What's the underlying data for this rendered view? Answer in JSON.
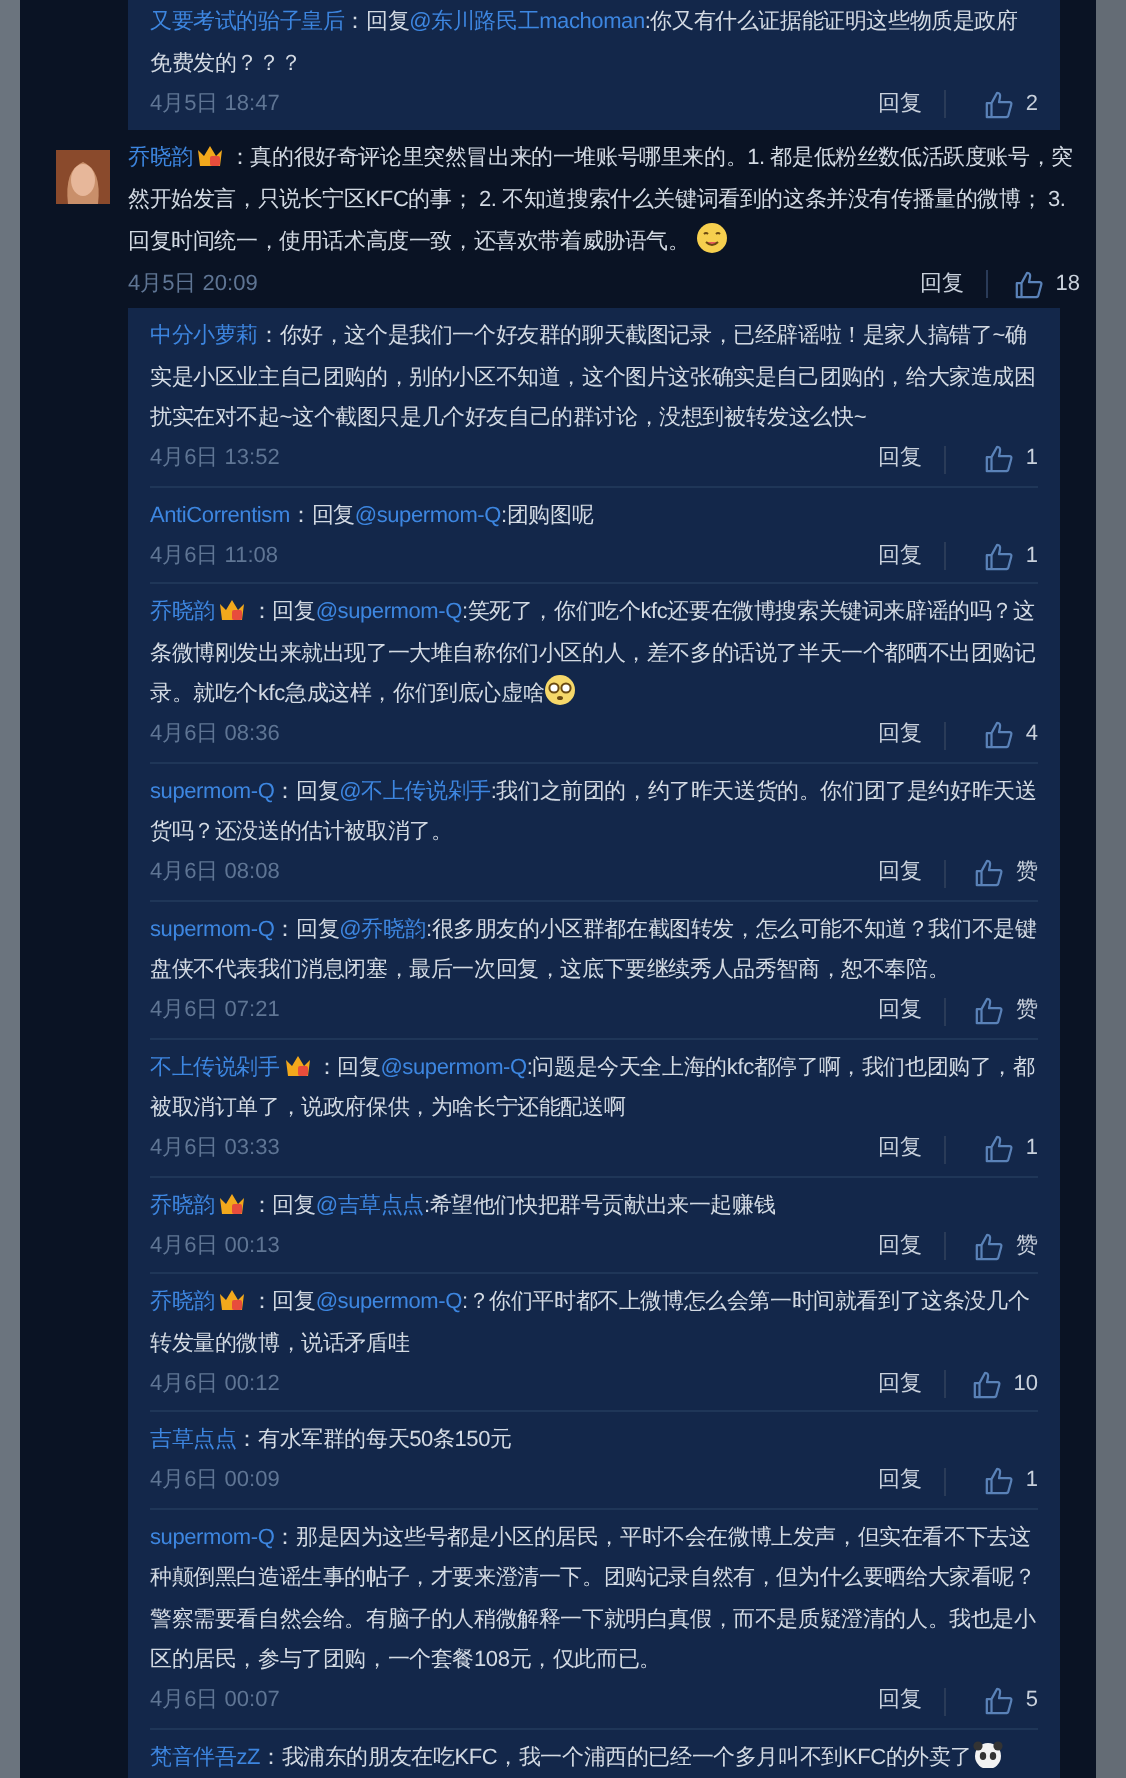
{
  "prev_replies": [
    {
      "user": "又要考试的骀子皇后",
      "badge": false,
      "lead": "：回复",
      "mention": "@东川路民工machoman",
      "text": ":你又有什么证据能证明这些物质是政府免费发的？？？",
      "time": "4月5日 18:47",
      "reply_label": "回复",
      "likes": "2"
    }
  ],
  "comment": {
    "user": "乔晓韵",
    "badge": true,
    "lead": "：",
    "text": "真的很好奇评论里突然冒出来的一堆账号哪里来的。1. 都是低粉丝数低活跃度账号，突然开始发言，只说长宁区KFC的事； 2. 不知道搜索什么关键词看到的这条并没有传播量的微博； 3. 回复时间统一，使用话术高度一致，还喜欢带着威胁语气。",
    "sticker": {
      "kind": "drool"
    },
    "time": "4月5日 20:09",
    "reply_label": "回复",
    "likes": "18"
  },
  "replies": [
    {
      "user": "中分小萝莉",
      "badge": false,
      "lead": "：",
      "text": "你好，这个是我们一个好友群的聊天截图记录，已经辟谣啦！是家人搞错了~确实是小区业主自己团购的，别的小区不知道，这个图片这张确实是自己团购的，给大家造成困扰实在对不起~这个截图只是几个好友自己的群讨论，没想到被转发这么快~",
      "time": "4月6日 13:52",
      "reply_label": "回复",
      "likes": "1"
    },
    {
      "user": "AntiCorrentism",
      "badge": false,
      "lead": "：回复",
      "mention": "@supermom-Q",
      "text": ":团购图呢",
      "time": "4月6日 11:08",
      "reply_label": "回复",
      "likes": "1"
    },
    {
      "user": "乔晓韵",
      "badge": true,
      "lead": "：回复",
      "mention": "@supermom-Q",
      "text": ":笑死了，你们吃个kfc还要在微博搜索关键词来辟谣的吗？这条微博刚发出来就出现了一大堆自称你们小区的人，差不多的话说了半天一个都晒不出团购记录。就吃个kfc急成这样，你们到底心虚啥",
      "sticker": {
        "kind": "shock"
      },
      "time": "4月6日 08:36",
      "reply_label": "回复",
      "likes": "4"
    },
    {
      "user": "supermom-Q",
      "badge": false,
      "lead": "：回复",
      "mention": "@不上传说剁手",
      "text": ":我们之前团的，约了昨天送货的。你们团了是约好昨天送货吗？还没送的估计被取消了。",
      "time": "4月6日 08:08",
      "reply_label": "回复",
      "likes": "赞"
    },
    {
      "user": "supermom-Q",
      "badge": false,
      "lead": "：回复",
      "mention": "@乔晓韵",
      "text": ":很多朋友的小区群都在截图转发，怎么可能不知道？我们不是键盘侠不代表我们消息闭塞，最后一次回复，这底下要继续秀人品秀智商，恕不奉陪。",
      "time": "4月6日 07:21",
      "reply_label": "回复",
      "likes": "赞"
    },
    {
      "user": "不上传说剁手",
      "badge": true,
      "lead": "：回复",
      "mention": "@supermom-Q",
      "text": ":问题是今天全上海的kfc都停了啊，我们也团购了，都被取消订单了，说政府保供，为啥长宁还能配送啊",
      "time": "4月6日 03:33",
      "reply_label": "回复",
      "likes": "1"
    },
    {
      "user": "乔晓韵",
      "badge": true,
      "lead": "：回复",
      "mention": "@吉草点点",
      "text": ":希望他们快把群号贡献出来一起赚钱",
      "time": "4月6日 00:13",
      "reply_label": "回复",
      "likes": "赞"
    },
    {
      "user": "乔晓韵",
      "badge": true,
      "lead": "：回复",
      "mention": "@supermom-Q",
      "text": ":？你们平时都不上微博怎么会第一时间就看到了这条没几个转发量的微博，说话矛盾哇",
      "time": "4月6日 00:12",
      "reply_label": "回复",
      "likes": "10"
    },
    {
      "user": "吉草点点",
      "badge": false,
      "lead": "：",
      "text": "有水军群的每天50条150元",
      "time": "4月6日 00:09",
      "reply_label": "回复",
      "likes": "1"
    },
    {
      "user": "supermom-Q",
      "badge": false,
      "lead": "：",
      "text": "那是因为这些号都是小区的居民，平时不会在微博上发声，但实在看不下去这种颠倒黑白造谣生事的帖子，才要来澄清一下。团购记录自然有，但为什么要晒给大家看呢？警察需要看自然会给。有脑子的人稍微解释一下就明白真假，而不是质疑澄清的人。我也是小区的居民，参与了团购，一个套餐108元，仅此而已。",
      "time": "4月6日 00:07",
      "reply_label": "回复",
      "likes": "5"
    },
    {
      "user": "梵音伴吾zZ",
      "badge": false,
      "lead": "：",
      "text": "我浦东的朋友在吃KFC，我一个浦西的已经一个多月叫不到KFC的外卖了",
      "sticker": {
        "kind": "panda"
      }
    }
  ]
}
